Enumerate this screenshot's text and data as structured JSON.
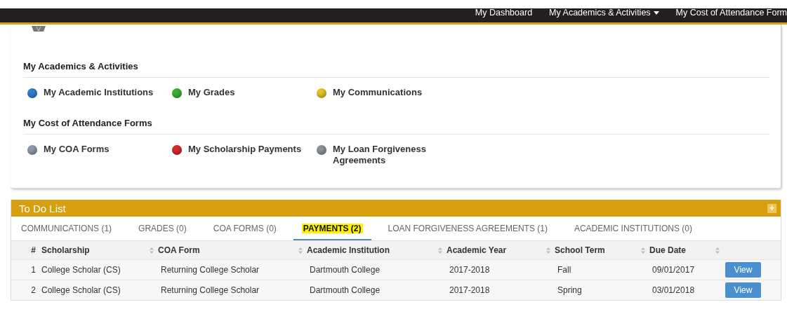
{
  "top_nav": [
    {
      "label": "My Dashboard",
      "dropdown": false
    },
    {
      "label": "My Academics & Activities",
      "dropdown": true
    },
    {
      "label": "My Cost of Attendance Form",
      "dropdown": false
    }
  ],
  "sections": [
    {
      "title": "My Academics & Activities",
      "items": [
        {
          "label": "My Academic Institutions",
          "color": "#2f7fd0"
        },
        {
          "label": "My Grades",
          "color": "#3cb034"
        },
        {
          "label": "My Communications",
          "color": "#e2c42a"
        }
      ]
    },
    {
      "title": "My Cost of Attendance Forms",
      "items": [
        {
          "label": "My COA Forms",
          "color": "#8c9aaa"
        },
        {
          "label": "My Scholarship Payments",
          "color": "#d42a2a"
        },
        {
          "label": "My Loan Forgiveness Agreements",
          "color": "#8e9194"
        }
      ]
    }
  ],
  "todo": {
    "title": "To Do List",
    "add_button": "+",
    "tabs": [
      {
        "label": "COMMUNICATIONS (1)",
        "selected": false
      },
      {
        "label": "GRADES (0)",
        "selected": false
      },
      {
        "label": "COA FORMS (0)",
        "selected": false
      },
      {
        "label": "PAYMENTS (2)",
        "selected": true
      },
      {
        "label": "LOAN FORGIVENESS AGREEMENTS (1)",
        "selected": false
      },
      {
        "label": "ACADEMIC INSTITUTIONS (0)",
        "selected": false
      }
    ],
    "columns": [
      {
        "label": "#",
        "sortable": false
      },
      {
        "label": "Scholarship",
        "sortable": false
      },
      {
        "label": "COA Form",
        "sortable": true
      },
      {
        "label": "Academic Institution",
        "sortable": true
      },
      {
        "label": "Academic Year",
        "sortable": true
      },
      {
        "label": "School Term",
        "sortable": true
      },
      {
        "label": "Due Date",
        "sortable": true
      },
      {
        "sortable": true
      }
    ],
    "rows": [
      {
        "cells": [
          "1",
          "College Scholar (CS)",
          "Returning College Scholar",
          "Dartmouth College",
          "2017-2018",
          "Fall",
          "09/01/2017"
        ],
        "action": "View"
      },
      {
        "cells": [
          "2",
          "College Scholar (CS)",
          "Returning College Scholar",
          "Dartmouth College",
          "2017-2018",
          "Spring",
          "03/01/2018"
        ],
        "action": "View"
      }
    ]
  }
}
